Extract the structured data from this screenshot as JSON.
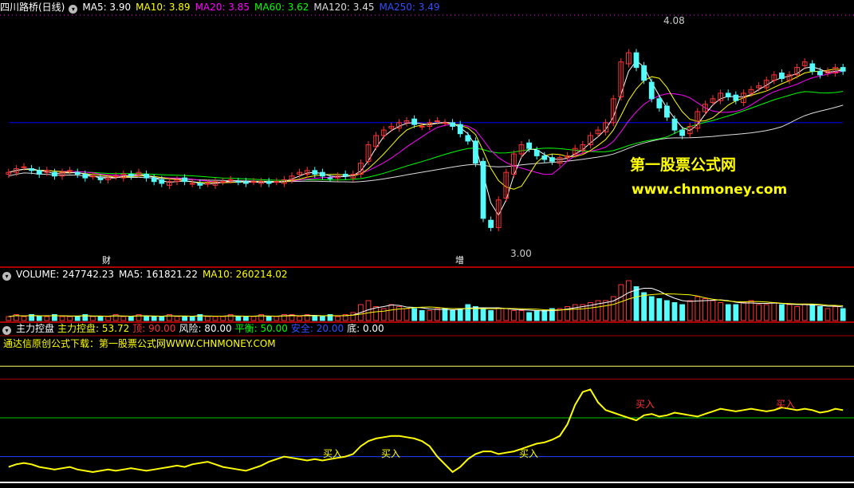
{
  "colors": {
    "up": "#ff3232",
    "down": "#54fcfc",
    "ma5": "#ffffff",
    "ma10": "#ffff00",
    "ma20": "#ff00ff",
    "ma60": "#00ff00",
    "ma120": "#dddddd",
    "ma250": "#0000ff",
    "k_line": "#ffff00",
    "separator": "#aa0000"
  },
  "main_header": {
    "stock_title": "四川路桥(日线)",
    "ma5": "MA5: 3.90",
    "ma10": "MA10: 3.89",
    "ma20": "MA20: 3.85",
    "ma60": "MA60: 3.62",
    "ma120": "MA120: 3.45",
    "ma250": "MA250: 3.49"
  },
  "main_annotations": {
    "high_label": "4.08",
    "low_label": "3.00",
    "marker_cai": "财",
    "marker_zeng": "增",
    "watermark_title": "第一股票公式网",
    "watermark_url": "www.chnmoney.com"
  },
  "volume_header": {
    "volume": "VOLUME: 247742.23",
    "ma5": "MA5: 161821.22",
    "ma10": "MA10: 260214.02"
  },
  "indicator_header": {
    "name": "主力控盘",
    "value": "主力控盘: 53.72",
    "ding": "顶: 90.00",
    "fengxian": "风险: 80.00",
    "pingheng": "平衡: 50.00",
    "anquan": "安全: 20.00",
    "di": "底: 0.00"
  },
  "indicator_note": "通达信原创公式下载：第一股票公式网WWW.CHNMONEY.COM",
  "indicator_annotations": [
    "买入",
    "买入",
    "买入",
    "买入",
    "买入"
  ],
  "chart_data": [
    {
      "type": "candlestick",
      "title": "四川路桥(日线)",
      "ylim": [
        2.9,
        4.2
      ],
      "annotated_high": 4.08,
      "annotated_low": 3.0,
      "moving_averages": {
        "MA5": 3.9,
        "MA10": 3.89,
        "MA20": 3.85,
        "MA60": 3.62,
        "MA120": 3.45,
        "MA250": 3.49
      },
      "close_series_approx": [
        3.35,
        3.37,
        3.38,
        3.36,
        3.34,
        3.36,
        3.33,
        3.35,
        3.36,
        3.34,
        3.32,
        3.33,
        3.31,
        3.32,
        3.33,
        3.34,
        3.33,
        3.35,
        3.32,
        3.3,
        3.29,
        3.3,
        3.31,
        3.3,
        3.29,
        3.28,
        3.29,
        3.3,
        3.3,
        3.31,
        3.3,
        3.29,
        3.3,
        3.3,
        3.29,
        3.3,
        3.31,
        3.33,
        3.35,
        3.36,
        3.34,
        3.33,
        3.32,
        3.33,
        3.33,
        3.34,
        3.4,
        3.5,
        3.55,
        3.58,
        3.6,
        3.62,
        3.63,
        3.61,
        3.6,
        3.62,
        3.63,
        3.62,
        3.6,
        3.56,
        3.52,
        3.4,
        3.1,
        3.05,
        3.2,
        3.35,
        3.45,
        3.5,
        3.48,
        3.44,
        3.42,
        3.41,
        3.43,
        3.44,
        3.48,
        3.5,
        3.55,
        3.58,
        3.62,
        3.75,
        3.95,
        4.0,
        3.92,
        3.85,
        3.75,
        3.7,
        3.65,
        3.58,
        3.55,
        3.6,
        3.68,
        3.72,
        3.75,
        3.78,
        3.76,
        3.74,
        3.78,
        3.8,
        3.82,
        3.85,
        3.88,
        3.86,
        3.88,
        3.92,
        3.95,
        3.9,
        3.88,
        3.9,
        3.92,
        3.9
      ]
    },
    {
      "type": "bar",
      "title": "VOLUME",
      "volume": 247742.23,
      "ma5": 161821.22,
      "ma10": 260214.02,
      "values_approx": [
        2,
        3,
        2,
        3,
        2,
        2,
        3,
        2,
        2,
        2,
        3,
        2,
        2,
        2,
        3,
        2,
        2,
        3,
        2,
        2,
        2,
        3,
        2,
        2,
        2,
        3,
        2,
        2,
        2,
        3,
        2,
        2,
        2,
        3,
        2,
        2,
        3,
        3,
        2,
        3,
        2,
        2,
        3,
        2,
        3,
        4,
        8,
        10,
        7,
        6,
        8,
        7,
        6,
        6,
        5,
        5,
        6,
        6,
        5,
        6,
        8,
        7,
        6,
        5,
        6,
        6,
        5,
        5,
        4,
        5,
        5,
        6,
        6,
        7,
        8,
        8,
        9,
        10,
        10,
        12,
        18,
        20,
        17,
        14,
        12,
        11,
        10,
        9,
        8,
        10,
        12,
        11,
        10,
        9,
        8,
        8,
        9,
        10,
        8,
        8,
        9,
        8,
        8,
        7,
        8,
        8,
        7,
        6,
        7,
        6
      ]
    },
    {
      "type": "line",
      "title": "主力控盘",
      "value": 53.72,
      "levels": {
        "顶": 90,
        "风险": 80,
        "平衡": 50,
        "安全": 20,
        "底": 0
      },
      "ylim": [
        0,
        100
      ],
      "values_approx": [
        12,
        14,
        15,
        14,
        12,
        11,
        10,
        11,
        12,
        10,
        9,
        8,
        9,
        10,
        9,
        10,
        11,
        10,
        9,
        10,
        11,
        12,
        13,
        12,
        14,
        15,
        16,
        14,
        12,
        11,
        10,
        9,
        11,
        13,
        16,
        18,
        20,
        19,
        18,
        17,
        18,
        17,
        18,
        19,
        20,
        22,
        28,
        32,
        34,
        35,
        36,
        36,
        35,
        34,
        32,
        28,
        20,
        14,
        8,
        12,
        18,
        22,
        24,
        24,
        22,
        23,
        24,
        26,
        28,
        30,
        31,
        33,
        36,
        45,
        60,
        70,
        72,
        62,
        56,
        54,
        52,
        50,
        48,
        52,
        53,
        51,
        52,
        54,
        53,
        52,
        51,
        53,
        55,
        57,
        56,
        55,
        56,
        57,
        56,
        55,
        56,
        58,
        57,
        56,
        57,
        56,
        54,
        55,
        57,
        56
      ]
    }
  ]
}
